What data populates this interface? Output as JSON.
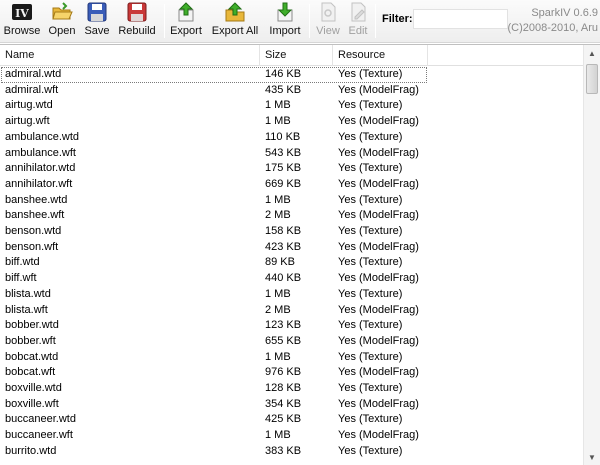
{
  "toolbar": {
    "browse": "Browse",
    "open": "Open",
    "save": "Save",
    "rebuild": "Rebuild",
    "export": "Export",
    "export_all": "Export All",
    "import": "Import",
    "view": "View",
    "edit": "Edit",
    "filter_label": "Filter:",
    "filter_value": ""
  },
  "about": {
    "version": "SparkIV 0.6.9",
    "copyright": "(C)2008-2010, Aru"
  },
  "columns": {
    "name": "Name",
    "size": "Size",
    "resource": "Resource"
  },
  "rows": [
    {
      "name": "admiral.wtd",
      "size": "146 KB",
      "resource": "Yes (Texture)"
    },
    {
      "name": "admiral.wft",
      "size": "435 KB",
      "resource": "Yes (ModelFrag)"
    },
    {
      "name": "airtug.wtd",
      "size": "1 MB",
      "resource": "Yes (Texture)"
    },
    {
      "name": "airtug.wft",
      "size": "1 MB",
      "resource": "Yes (ModelFrag)"
    },
    {
      "name": "ambulance.wtd",
      "size": "110 KB",
      "resource": "Yes (Texture)"
    },
    {
      "name": "ambulance.wft",
      "size": "543 KB",
      "resource": "Yes (ModelFrag)"
    },
    {
      "name": "annihilator.wtd",
      "size": "175 KB",
      "resource": "Yes (Texture)"
    },
    {
      "name": "annihilator.wft",
      "size": "669 KB",
      "resource": "Yes (ModelFrag)"
    },
    {
      "name": "banshee.wtd",
      "size": "1 MB",
      "resource": "Yes (Texture)"
    },
    {
      "name": "banshee.wft",
      "size": "2 MB",
      "resource": "Yes (ModelFrag)"
    },
    {
      "name": "benson.wtd",
      "size": "158 KB",
      "resource": "Yes (Texture)"
    },
    {
      "name": "benson.wft",
      "size": "423 KB",
      "resource": "Yes (ModelFrag)"
    },
    {
      "name": "biff.wtd",
      "size": "89 KB",
      "resource": "Yes (Texture)"
    },
    {
      "name": "biff.wft",
      "size": "440 KB",
      "resource": "Yes (ModelFrag)"
    },
    {
      "name": "blista.wtd",
      "size": "1 MB",
      "resource": "Yes (Texture)"
    },
    {
      "name": "blista.wft",
      "size": "2 MB",
      "resource": "Yes (ModelFrag)"
    },
    {
      "name": "bobber.wtd",
      "size": "123 KB",
      "resource": "Yes (Texture)"
    },
    {
      "name": "bobber.wft",
      "size": "655 KB",
      "resource": "Yes (ModelFrag)"
    },
    {
      "name": "bobcat.wtd",
      "size": "1 MB",
      "resource": "Yes (Texture)"
    },
    {
      "name": "bobcat.wft",
      "size": "976 KB",
      "resource": "Yes (ModelFrag)"
    },
    {
      "name": "boxville.wtd",
      "size": "128 KB",
      "resource": "Yes (Texture)"
    },
    {
      "name": "boxville.wft",
      "size": "354 KB",
      "resource": "Yes (ModelFrag)"
    },
    {
      "name": "buccaneer.wtd",
      "size": "425 KB",
      "resource": "Yes (Texture)"
    },
    {
      "name": "buccaneer.wft",
      "size": "1 MB",
      "resource": "Yes (ModelFrag)"
    },
    {
      "name": "burrito.wtd",
      "size": "383 KB",
      "resource": "Yes (Texture)"
    }
  ]
}
